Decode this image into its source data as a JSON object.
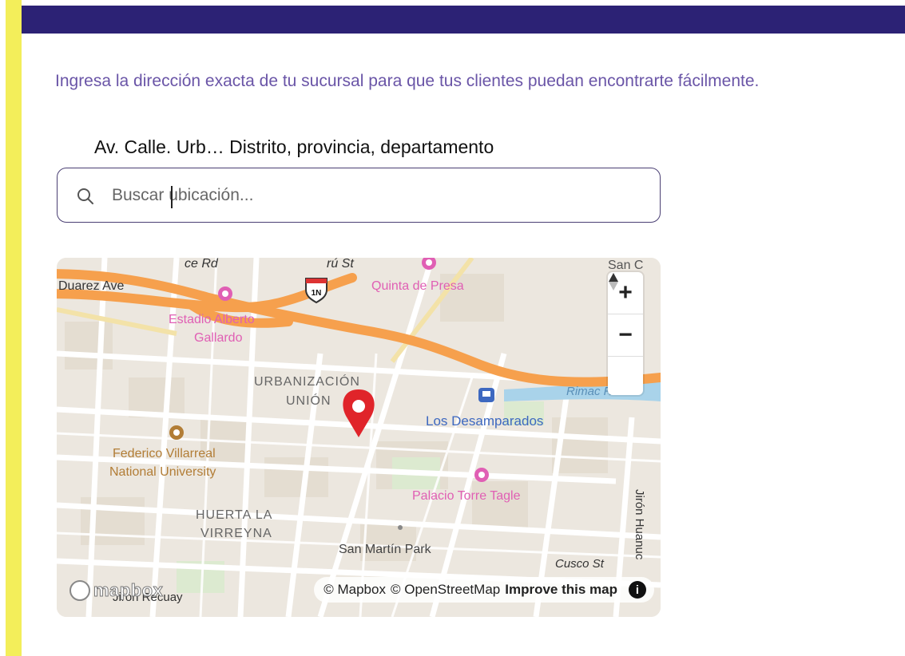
{
  "form": {
    "description": "Ingresa la dirección exacta de tu sucursal para que tus clientes puedan encontrarte fácilmente.",
    "hint": "Av. Calle. Urb… Distrito, provincia, departamento"
  },
  "search": {
    "placeholder": "Buscar ubicación...",
    "value": "",
    "icon": "search-icon"
  },
  "map": {
    "labels": {
      "duarez_ave": "Duarez Ave",
      "rd": "ce Rd",
      "ru_st": "rú St",
      "quinta_de_presa": "Quinta de Presa",
      "san_c": "San C",
      "estadio_1": "Estadio Alberto",
      "estadio_2": "Gallardo",
      "urbanizacion_1": "URBANIZACIÓN",
      "urbanizacion_2": "UNIÓN",
      "rimac_river": "Rimac River",
      "los_desamparados": "Los Desamparados",
      "federico_1": "Federico Villarreal",
      "federico_2": "National University",
      "palacio": "Palacio Torre Tagle",
      "huerta_1": "HUERTA LA",
      "huerta_2": "VIRREYNA",
      "san_martin": "San Martín Park",
      "cusco": "Cusco St",
      "jiron_huanuco": "Jirón Huanuc",
      "jiron_recuay": "Jirón Recuay",
      "highway": "1N"
    },
    "controls": {
      "zoom_in": "+",
      "zoom_out": "−",
      "compass": "▲"
    },
    "attribution": {
      "mapbox": "© Mapbox",
      "osm": "© OpenStreetMap",
      "improve": "Improve this map",
      "info": "i"
    },
    "logo_text": "mapbox",
    "colors": {
      "highway": "#f6a04d",
      "river": "#a9d3ea",
      "pin": "#e0242a",
      "poi_pink": "#e05fb4",
      "poi_blue": "#3d68c0",
      "poi_brown": "#b27d36"
    }
  },
  "colors": {
    "accent_bar": "#f3ee5a",
    "header": "#2c2275",
    "description_text": "#6a55a7"
  }
}
